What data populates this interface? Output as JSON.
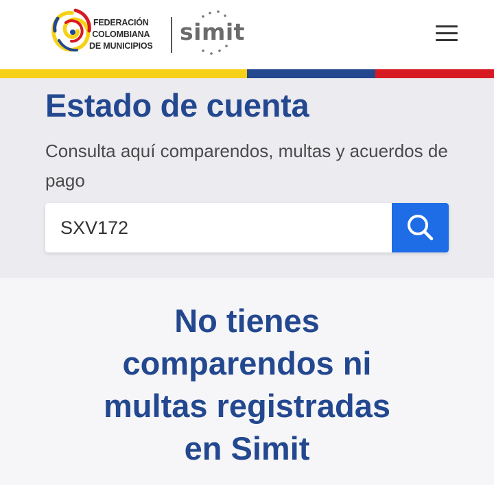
{
  "header": {
    "logo": {
      "org_lines": [
        "FEDERACIÓN",
        "COLOMBIANA",
        "DE MUNICIPIOS"
      ],
      "brand": "simit",
      "icon": "fcm-swirl-logo"
    },
    "menu_icon": "hamburger-menu-icon"
  },
  "flag_colors": {
    "yellow": "#f7d117",
    "blue": "#23488f",
    "red": "#d71a21"
  },
  "hero": {
    "title": "Estado de cuenta",
    "subtitle": "Consulta aquí comparendos, multas y acuerdos de pago",
    "search": {
      "value": "SXV172",
      "button_icon": "search-icon"
    }
  },
  "result": {
    "lines": [
      "No tienes",
      "comparendos ni",
      "multas registradas",
      "en Simit"
    ]
  },
  "colors": {
    "primary": "#23488f",
    "button": "#1e6ce6"
  }
}
